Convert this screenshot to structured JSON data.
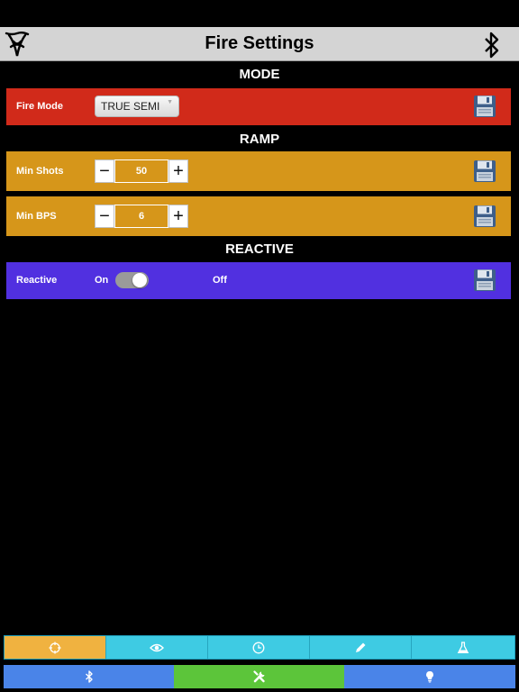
{
  "header": {
    "title": "Fire Settings",
    "logo_icon": "angelic-rune-icon",
    "right_icon": "bluetooth-icon"
  },
  "sections": {
    "mode": "MODE",
    "ramp": "RAMP",
    "reactive": "REACTIVE"
  },
  "fire_mode": {
    "label": "Fire Mode",
    "value": "TRUE SEMI",
    "color": "#d12a1a"
  },
  "min_shots": {
    "label": "Min Shots",
    "value": "50",
    "minus": "−",
    "plus": "+",
    "color": "#d6961a"
  },
  "min_bps": {
    "label": "Min BPS",
    "value": "6",
    "minus": "−",
    "plus": "+",
    "color": "#d6961a"
  },
  "reactive": {
    "label": "Reactive",
    "on_label": "On",
    "off_label": "Off",
    "enabled": false,
    "color": "#5130e0"
  },
  "save_icon": "floppy-disk-icon",
  "tab_bar_top": [
    {
      "icon": "crosshair-icon",
      "active": true
    },
    {
      "icon": "eye-icon",
      "active": false
    },
    {
      "icon": "clock-icon",
      "active": false
    },
    {
      "icon": "pencil-icon",
      "active": false
    },
    {
      "icon": "flask-icon",
      "active": false
    }
  ],
  "tab_bar_bottom": [
    {
      "icon": "bluetooth-icon",
      "color": "#4a84e8"
    },
    {
      "icon": "tools-icon",
      "color": "#5cc53a"
    },
    {
      "icon": "lightbulb-icon",
      "color": "#4a84e8"
    }
  ],
  "colors": {
    "tab_top_bg": "#3ecbe3",
    "tab_top_active": "#f0b240",
    "navbar_bg": "#d4d4d4"
  }
}
